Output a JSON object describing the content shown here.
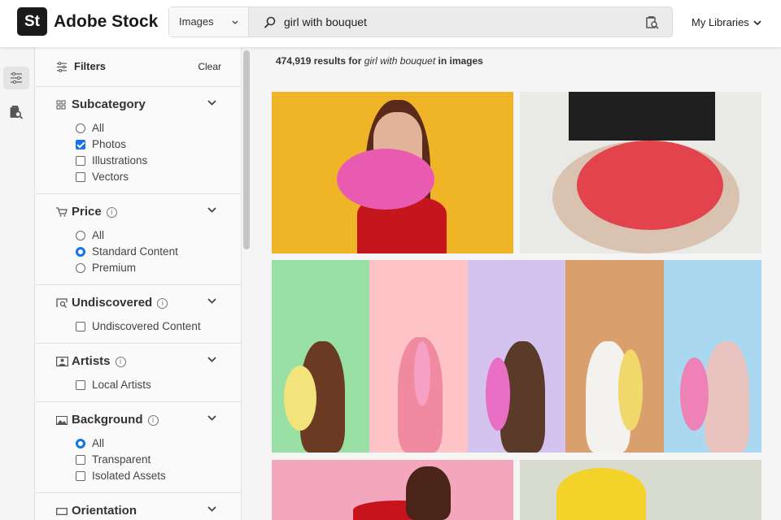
{
  "header": {
    "logo": "St",
    "brand": "Adobe Stock",
    "search_type": "Images",
    "search_query": "girl with bouquet",
    "libraries": "My Libraries"
  },
  "filters": {
    "title": "Filters",
    "clear": "Clear",
    "sections": [
      {
        "title": "Subcategory",
        "options": [
          "All",
          "Photos",
          "Illustrations",
          "Vectors"
        ]
      },
      {
        "title": "Price",
        "options": [
          "All",
          "Standard Content",
          "Premium"
        ]
      },
      {
        "title": "Undiscovered",
        "options": [
          "Undiscovered Content"
        ]
      },
      {
        "title": "Artists",
        "options": [
          "Local Artists"
        ]
      },
      {
        "title": "Background",
        "options": [
          "All",
          "Transparent",
          "Isolated Assets"
        ]
      },
      {
        "title": "Orientation"
      }
    ]
  },
  "results": {
    "count": "474,919",
    "pre": "results for",
    "query": "girl with bouquet",
    "post": "in images"
  },
  "colors": {
    "accent": "#1473e6"
  }
}
